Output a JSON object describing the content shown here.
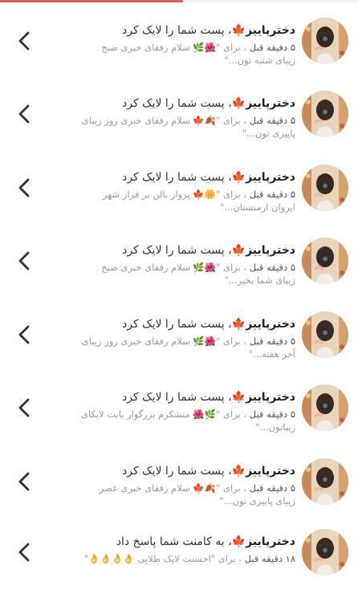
{
  "notifications": [
    {
      "name": "دخترپاییز🍁",
      "action": "، پست شما را لایک کرد",
      "time": "۵ دقیقه قبل",
      "sep": "،",
      "for": "برای",
      "snippet": "\"🌺🌿 سلام رفقای خبری صبح زیبای شنبه تون...\""
    },
    {
      "name": "دخترپاییز🍁",
      "action": "، پست شما را لایک کرد",
      "time": "۵ دقیقه قبل",
      "sep": "،",
      "for": "برای",
      "snippet": "\"🍂🍁 سلام رفقای خبری روز زیبای پاییزی تون...\""
    },
    {
      "name": "دخترپاییز🍁",
      "action": "، پست شما را لایک کرد",
      "time": "۵ دقیقه قبل",
      "sep": "،",
      "for": "برای",
      "snippet": "\"🌼🍁 پرواز بالن بر فراز شهر ایروان ارمنستان...\""
    },
    {
      "name": "دخترپاییز🍁",
      "action": "، پست شما را لایک کرد",
      "time": "۵ دقیقه قبل",
      "sep": "،",
      "for": "برای",
      "snippet": "\"🌺🌿 سلام رفقای خبری صبح زیبای شما بخیر...\""
    },
    {
      "name": "دخترپاییز🍁",
      "action": "، پست شما را لایک کرد",
      "time": "۵ دقیقه قبل",
      "sep": "،",
      "for": "برای",
      "snippet": "\"🌺🌿 سلام رفقای خبری روز زیبای آخر هفته...\""
    },
    {
      "name": "دخترپاییز🍁",
      "action": "، پست شما را لایک کرد",
      "time": "۵ دقیقه قبل",
      "sep": "،",
      "for": "برای",
      "snippet": "\"🌿🌺 متشکرم بزرگوار بابت لایکای زیباتون...\""
    },
    {
      "name": "دخترپاییز🍁",
      "action": "، پست شما را لایک کرد",
      "time": "۵ دقیقه قبل",
      "sep": "،",
      "for": "برای",
      "snippet": "\"🍂🍁 سلام رفقای خبری عصر زیبای پاییزی تون...\""
    },
    {
      "name": "دخترپاییز🍁",
      "action": "، به کامنت شما پاسخ داد",
      "time": "۱۸ دقیقه قبل",
      "sep": "،",
      "for": "برای",
      "snippet": "\"احسنت لایک طلایی 👌👌👌👌\""
    }
  ]
}
